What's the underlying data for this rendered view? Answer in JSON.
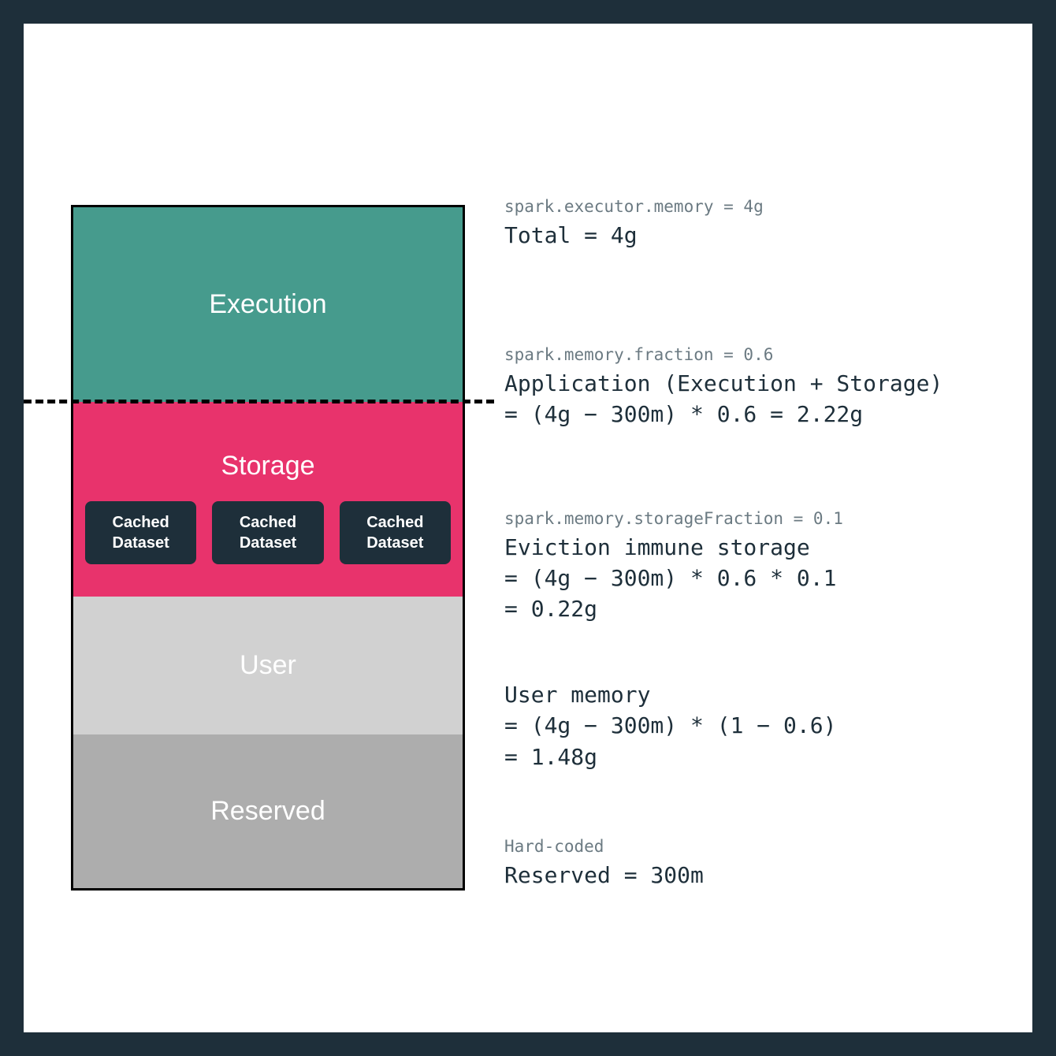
{
  "memory_stack": {
    "execution": {
      "label": "Execution"
    },
    "storage": {
      "label": "Storage",
      "cached": [
        {
          "line1": "Cached",
          "line2": "Dataset"
        },
        {
          "line1": "Cached",
          "line2": "Dataset"
        },
        {
          "line1": "Cached",
          "line2": "Dataset"
        }
      ]
    },
    "user": {
      "label": "User"
    },
    "reserved": {
      "label": "Reserved"
    }
  },
  "annotations": {
    "total": {
      "config": "spark.executor.memory = 4g",
      "value": "Total = 4g"
    },
    "application": {
      "config": "spark.memory.fraction = 0.6",
      "value_l1": "Application (Execution + Storage)",
      "value_l2": "= (4g − 300m) * 0.6 = 2.22g"
    },
    "eviction": {
      "config": "spark.memory.storageFraction = 0.1",
      "value_l1": "Eviction immune storage",
      "value_l2": "= (4g − 300m) * 0.6 * 0.1",
      "value_l3": "= 0.22g"
    },
    "user": {
      "value_l1": "User memory",
      "value_l2": "= (4g − 300m) * (1 − 0.6)",
      "value_l3": "= 1.48g"
    },
    "reserved": {
      "config": "Hard-coded",
      "value": "Reserved = 300m"
    }
  }
}
